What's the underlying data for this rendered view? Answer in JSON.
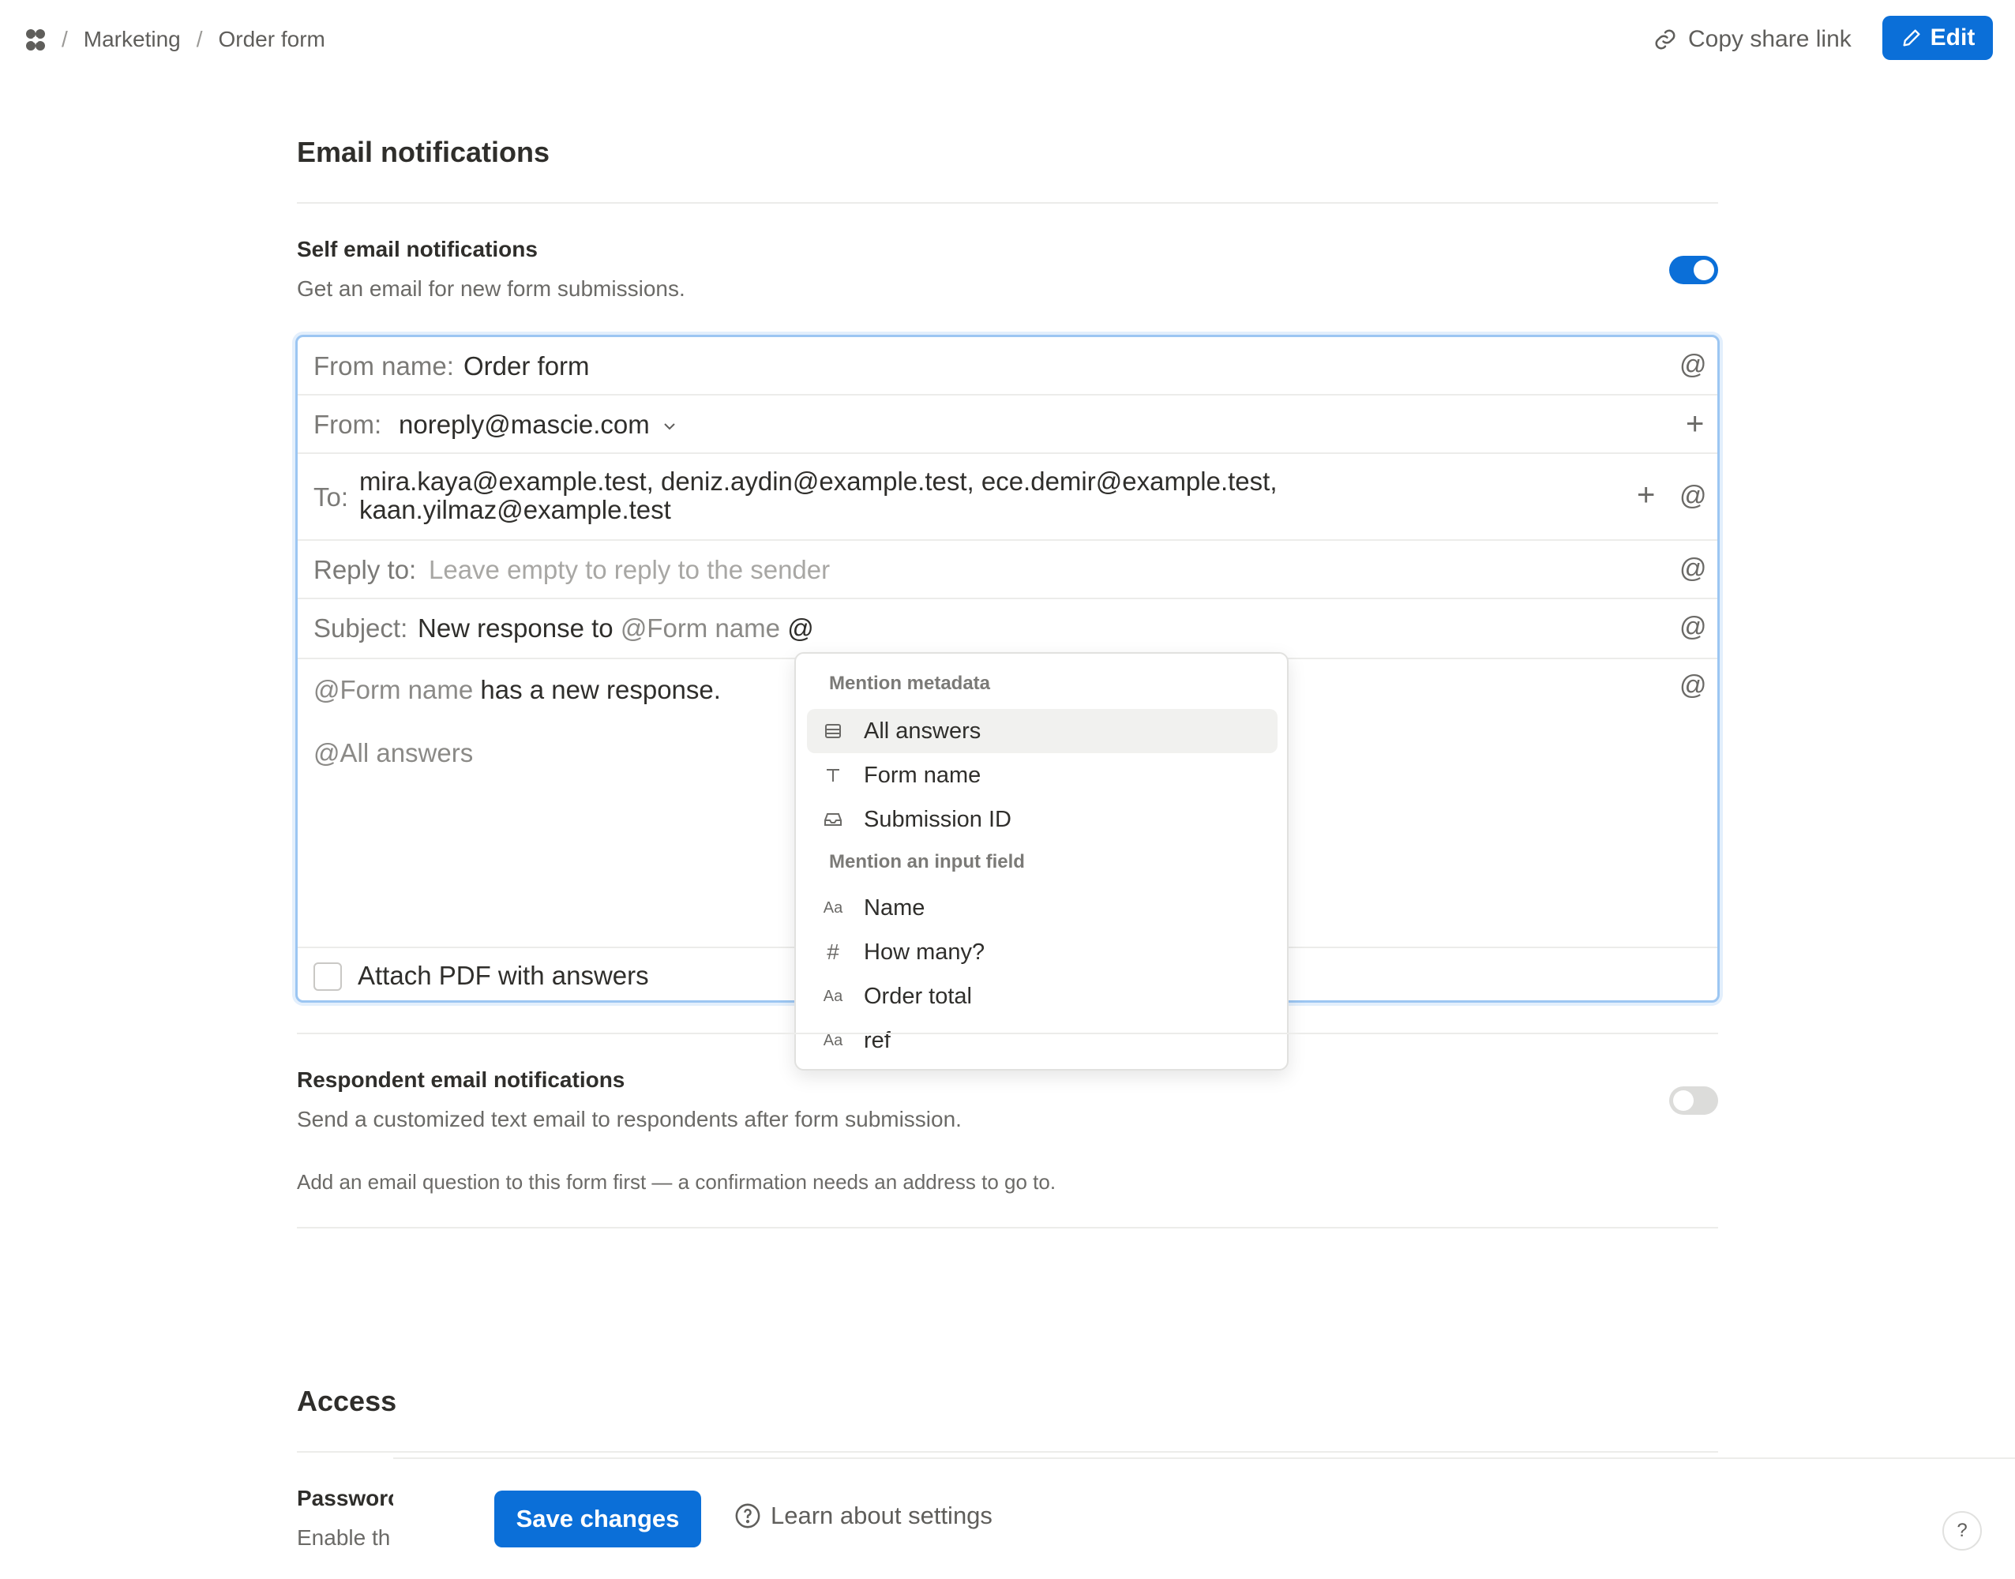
{
  "breadcrumb": {
    "separator": "/",
    "items": [
      "Marketing",
      "Order form"
    ]
  },
  "header": {
    "copy_link_label": "Copy share link",
    "edit_label": "Edit"
  },
  "email_notifications": {
    "title": "Email notifications",
    "self": {
      "title": "Self email notifications",
      "description": "Get an email for new form submissions.",
      "enabled": true
    },
    "editor": {
      "from_name_label": "From name:",
      "from_name_value": "Order form",
      "from_label": "From:",
      "from_value": "noreply@mascie.com",
      "to_label": "To:",
      "to_line1": "mira.kaya@example.test, deniz.aydin@example.test, ece.demir@example.test,",
      "to_line2": "kaan.yilmaz@example.test",
      "reply_to_label": "Reply to:",
      "reply_to_placeholder": "Leave empty to reply to the sender",
      "subject_label": "Subject:",
      "subject_text": "New response to",
      "subject_token": "@Form name",
      "subject_trailing": "@",
      "body_token": "@Form name",
      "body_text": "has a new response.",
      "body_answers_token": "@All answers",
      "attach_label": "Attach PDF with answers",
      "attach_checked": false
    },
    "respondent": {
      "title": "Respondent email notifications",
      "description": "Send a customized text email to respondents after form submission.",
      "note": "Add an email question to this form first — a confirmation needs an address to go to.",
      "enabled": false
    }
  },
  "mention_menu": {
    "metadata_heading": "Mention metadata",
    "metadata_items": [
      {
        "label": "All answers",
        "icon": "table-icon",
        "selected": true
      },
      {
        "label": "Form name",
        "icon": "text-icon",
        "selected": false
      },
      {
        "label": "Submission ID",
        "icon": "inbox-icon",
        "selected": false
      }
    ],
    "fields_heading": "Mention an input field",
    "field_items": [
      {
        "label": "Name",
        "icon": "Aa"
      },
      {
        "label": "How many?",
        "icon": "#"
      },
      {
        "label": "Order total",
        "icon": "Aa"
      },
      {
        "label": "ref",
        "icon": "Aa"
      }
    ]
  },
  "access": {
    "title": "Access",
    "password_title_partial": "Passworc",
    "password_desc_partial": "Enable th"
  },
  "footer": {
    "save_label": "Save changes",
    "learn_label": "Learn about settings",
    "help_label": "?"
  },
  "colors": {
    "accent": "#0b6fd8",
    "focus_border": "#9cc6f2"
  }
}
